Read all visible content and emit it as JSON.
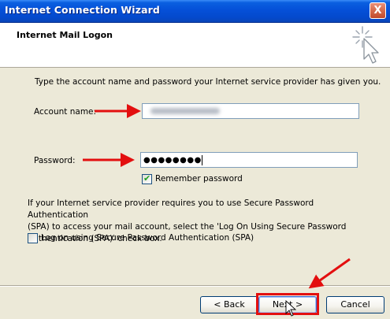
{
  "window": {
    "title": "Internet Connection Wizard",
    "close_glyph": "X"
  },
  "header": {
    "title": "Internet Mail Logon",
    "icon": "wizard-sparkle-cursor-icon"
  },
  "form": {
    "intro": "Type the account name and password your Internet service provider has given you.",
    "account_label": "Account name:",
    "account_value_note": "blurred",
    "password_label": "Password:",
    "password_value": "●●●●●●●●",
    "remember_label": "Remember password",
    "remember_checked": true,
    "spa_text_1": "If your Internet service provider requires you to use Secure Password Authentication",
    "spa_text_2": "(SPA) to access your mail account, select the 'Log On Using Secure Password",
    "spa_text_3": "Authentication (SPA)' check box.",
    "spa_label": "Log on using Secure Password Authentication (SPA)",
    "spa_checked": false
  },
  "buttons": {
    "back": "< Back",
    "next": "Next >",
    "cancel": "Cancel"
  },
  "colors": {
    "annotation_red": "#e30f0f",
    "titlebar_blue": "#0550d8",
    "window_bg": "#ece9d8"
  }
}
